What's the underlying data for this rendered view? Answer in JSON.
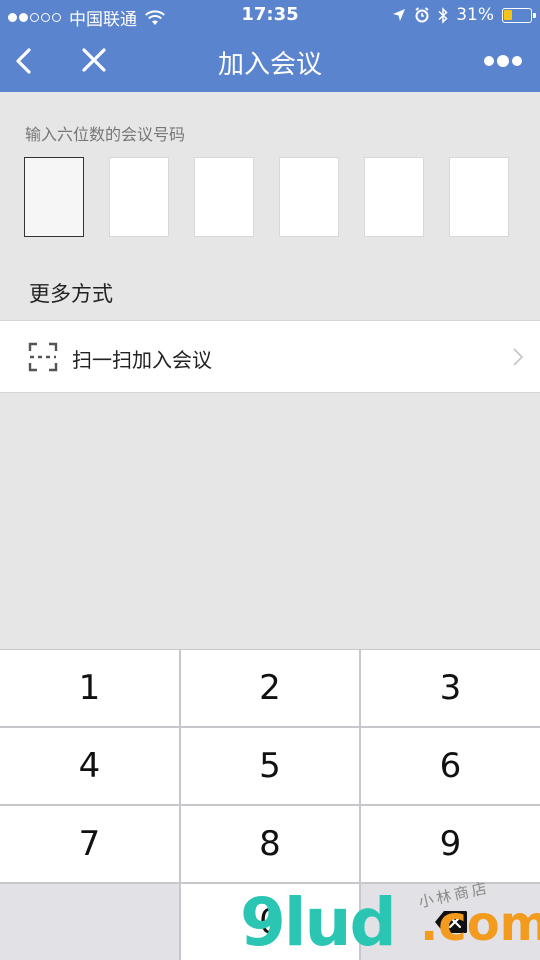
{
  "status_bar": {
    "carrier": "中国联通",
    "time": "17:35",
    "battery_percent": "31%",
    "signal_dots_filled": 2,
    "signal_dots_total": 5
  },
  "nav": {
    "title": "加入会议",
    "back_icon": "chevron-left-icon",
    "close_icon": "close-icon",
    "more_icon": "more-dots-icon"
  },
  "code_entry": {
    "label": "输入六位数的会议号码",
    "digits": [
      "",
      "",
      "",
      "",
      "",
      ""
    ]
  },
  "more_options": {
    "title": "更多方式",
    "scan_label": "扫一扫加入会议"
  },
  "keypad": {
    "keys": [
      "1",
      "2",
      "3",
      "4",
      "5",
      "6",
      "7",
      "8",
      "9",
      "0"
    ]
  },
  "watermark": {
    "main": "9lud",
    "sub": ".com",
    "small": "小林商店"
  },
  "colors": {
    "nav_bg": "#5b84cf",
    "page_bg": "#e6e6e6",
    "battery_fill": "#f7c51a"
  }
}
